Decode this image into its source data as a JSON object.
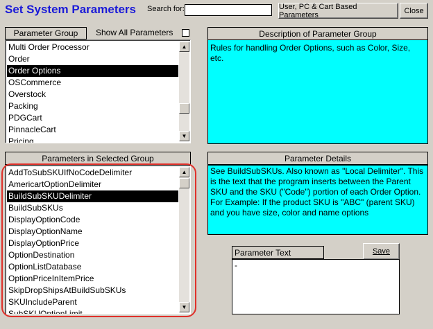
{
  "header": {
    "title": "Set System Parameters",
    "search_label": "Search for:",
    "search_value": "",
    "user_pc_cart_button": "User, PC & Cart Based Parameters",
    "close_button": "Close"
  },
  "group_panel": {
    "header": "Parameter Group",
    "show_all_label": "Show All Parameters",
    "show_all_checked": false,
    "items": [
      "Multi Order Processor",
      "Order",
      "Order Options",
      "OSCommerce",
      "Overstock",
      "Packing",
      "PDGCart",
      "PinnacleCart",
      "Pricing"
    ],
    "selected_index": 2
  },
  "description_panel": {
    "header": "Description of Parameter Group",
    "text": "Rules for handling Order Options, such as Color, Size, etc."
  },
  "params_panel": {
    "header": "Parameters in Selected Group",
    "items": [
      "AddToSubSKUIfNoCodeDelimiter",
      "AmericartOptionDelimiter",
      "BuildSubSKUDelimiter",
      "BuildSubSKUs",
      "DisplayOptionCode",
      "DisplayOptionName",
      "DisplayOptionPrice",
      "OptionDestination",
      "OptionListDatabase",
      "OptionPriceInItemPrice",
      "SkipDropShipsAtBuildSubSKUs",
      "SKUIncludeParent",
      "SubSKUOptionLimit"
    ],
    "selected_index": 2
  },
  "details_panel": {
    "header": "Parameter Details",
    "text": "See BuildSubSKUs. Also known as \"Local Delimiter\". This is the text that the program inserts between the Parent SKU and the SKU (\"Code\") portion of each Order Option.\nFor Example: If the product SKU is \"ABC\" (parent SKU) and you have size, color and name options"
  },
  "param_text": {
    "label": "Parameter Text",
    "save_button": "Save",
    "value": "-"
  },
  "colors": {
    "title": "#1a1ad8",
    "cyan_panel": "#00ffff",
    "selection": "#000000",
    "highlight_ring": "#e0302a"
  }
}
